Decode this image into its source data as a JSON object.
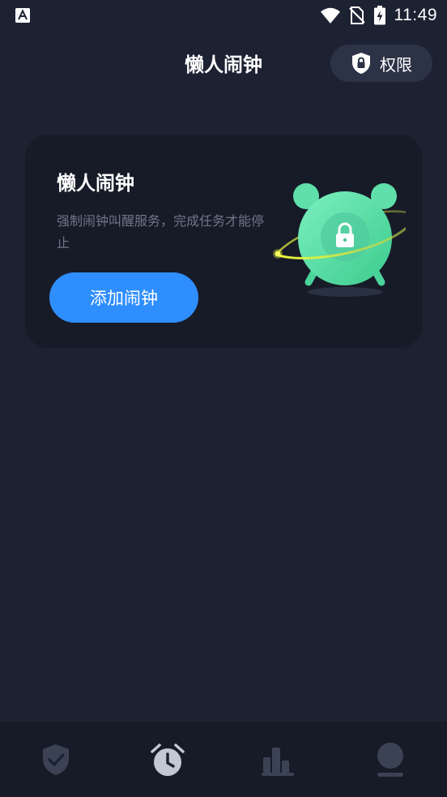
{
  "status_bar": {
    "time": "11:49",
    "icons": [
      "app-notification-icon",
      "wifi-icon",
      "no-sim-icon",
      "battery-charging-icon"
    ]
  },
  "header": {
    "title": "懒人闹钟",
    "permission_button": {
      "label": "权限",
      "icon": "shield-lock-icon"
    }
  },
  "hero_card": {
    "title": "懒人闹钟",
    "description": "强制闹钟叫醒服务，完成任务才能停止",
    "add_button_label": "添加闹钟",
    "illustration": "alarm-clock-lock-icon"
  },
  "bottom_nav": {
    "items": [
      {
        "icon": "shield-check-icon",
        "active": false
      },
      {
        "icon": "alarm-clock-icon",
        "active": true
      },
      {
        "icon": "bar-chart-icon",
        "active": false
      },
      {
        "icon": "profile-icon",
        "active": false
      }
    ]
  },
  "colors": {
    "background": "#1d2233",
    "card": "#171b28",
    "accent_blue": "#2f8efe",
    "alarm_green": "#5ee2a6",
    "nav_inactive": "#3b4254",
    "nav_active": "#c3c8d4"
  }
}
